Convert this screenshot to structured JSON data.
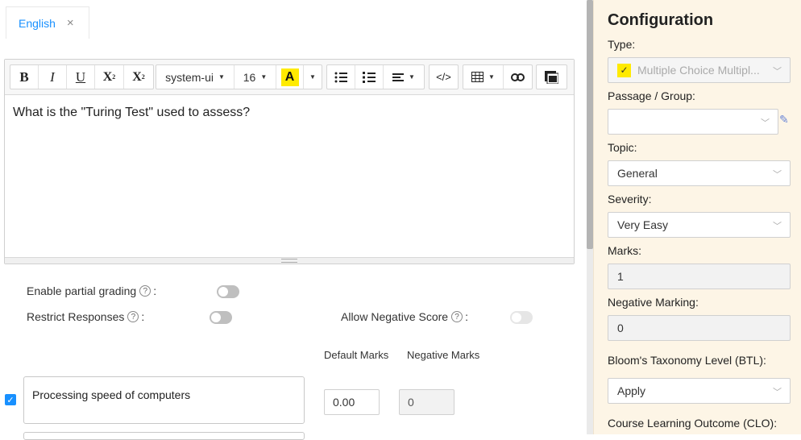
{
  "tabs": [
    {
      "label": "English",
      "close": "×"
    }
  ],
  "toolbar": {
    "bold": "B",
    "italic": "I",
    "underline": "U",
    "superscript": "X",
    "subscript": "X",
    "font_family": "system-ui",
    "font_size": "16",
    "highlight": "A",
    "code": "</>"
  },
  "question": {
    "text": "What is the \"Turing Test\" used to assess?"
  },
  "options": {
    "partial_grading_label": "Enable partial grading",
    "restrict_responses_label": "Restrict Responses",
    "allow_negative_label": "Allow Negative Score",
    "help_glyph": "?",
    "colon": ":"
  },
  "answers": {
    "col_default_marks": "Default Marks",
    "col_negative_marks": "Negative Marks",
    "rows": [
      {
        "text": "Processing speed of computers",
        "checked": true,
        "default_marks": "0.00",
        "negative_marks": "0"
      }
    ]
  },
  "config": {
    "title": "Configuration",
    "type_label": "Type:",
    "type_value": "Multiple Choice Multipl...",
    "passage_label": "Passage / Group:",
    "passage_value": "",
    "topic_label": "Topic:",
    "topic_value": "General",
    "severity_label": "Severity:",
    "severity_value": "Very Easy",
    "marks_label": "Marks:",
    "marks_value": "1",
    "negative_marking_label": "Negative Marking:",
    "negative_marking_value": "0",
    "btl_label": "Bloom's Taxonomy Level (BTL):",
    "btl_value": "Apply",
    "clo_label": "Course Learning Outcome (CLO):"
  },
  "colors": {
    "accent": "#1890ff",
    "sidebar_bg": "#fdf5e6",
    "highlight": "#ffeb00"
  }
}
